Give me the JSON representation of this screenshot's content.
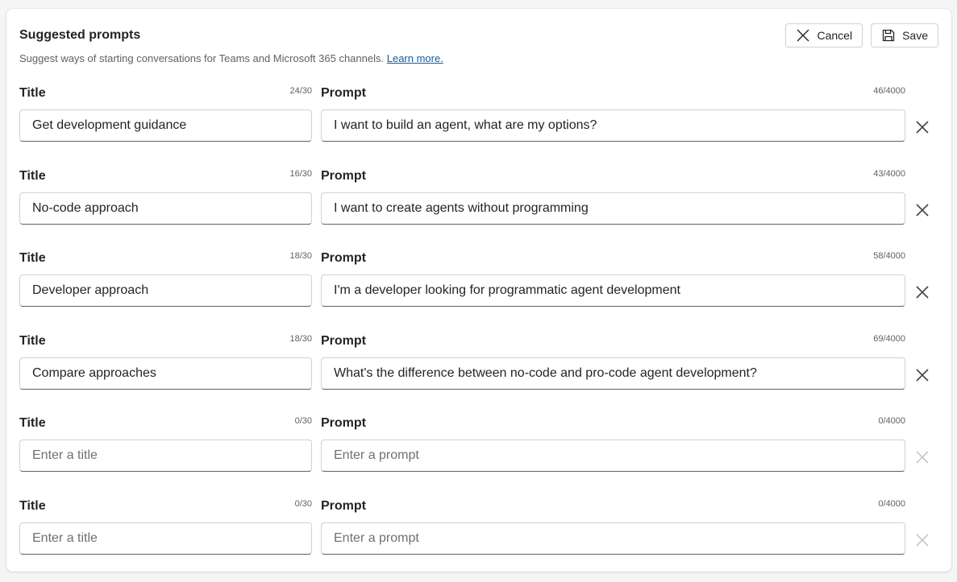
{
  "header": {
    "title": "Suggested prompts",
    "description": "Suggest ways of starting conversations for Teams and Microsoft 365 channels.",
    "learn_more": "Learn more.",
    "cancel_label": "Cancel",
    "save_label": "Save"
  },
  "labels": {
    "title": "Title",
    "prompt": "Prompt"
  },
  "colors": {
    "link": "#115ea3",
    "remove_active": "#424242",
    "remove_disabled": "#c7c7c7"
  },
  "prompts": [
    {
      "title": "Get development guidance",
      "title_count": "24/30",
      "prompt": "I want to build an agent, what are my options?",
      "prompt_count": "46/4000"
    },
    {
      "title": "No-code approach",
      "title_count": "16/30",
      "prompt": "I want to create agents without programming",
      "prompt_count": "43/4000"
    },
    {
      "title": "Developer approach",
      "title_count": "18/30",
      "prompt": "I'm a developer looking for programmatic agent development",
      "prompt_count": "58/4000"
    },
    {
      "title": "Compare approaches",
      "title_count": "18/30",
      "prompt": "What's the difference between no-code and pro-code agent development?",
      "prompt_count": "69/4000"
    },
    {
      "title": "",
      "title_placeholder": "Enter a title",
      "title_count": "0/30",
      "prompt": "",
      "prompt_placeholder": "Enter a prompt",
      "prompt_count": "0/4000"
    },
    {
      "title": "",
      "title_placeholder": "Enter a title",
      "title_count": "0/30",
      "prompt": "",
      "prompt_placeholder": "Enter a prompt",
      "prompt_count": "0/4000"
    }
  ]
}
